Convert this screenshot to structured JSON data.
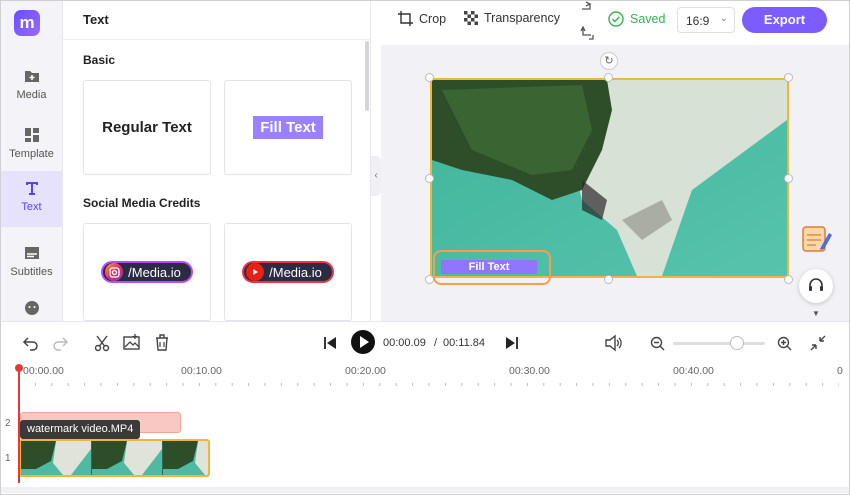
{
  "rail": {
    "logo": "m",
    "items": [
      {
        "label": "Media"
      },
      {
        "label": "Template"
      },
      {
        "label": "Text"
      },
      {
        "label": "Subtitles"
      }
    ]
  },
  "panel": {
    "title": "Text",
    "sections": {
      "basic": "Basic",
      "social": "Social Media Credits"
    },
    "cards": {
      "regular": "Regular Text",
      "fill": "Fill Text",
      "instagram": "/Media.io",
      "youtube": "/Media.io"
    }
  },
  "toolbar": {
    "crop": "Crop",
    "transparency": "Transparency",
    "saved": "Saved",
    "ratio": "16:9",
    "export": "Export"
  },
  "canvas": {
    "overlay_text": "Fill Text"
  },
  "playback": {
    "current": "00:00.09",
    "separator": "/",
    "total": "00:11.84"
  },
  "timeline": {
    "ticks": [
      "00:00.00",
      "00:10.00",
      "00:20.00",
      "00:30.00",
      "00:40.00"
    ],
    "track_numbers": [
      "2",
      "1"
    ],
    "clip_tooltip": "watermark video.MP4"
  },
  "colors": {
    "accent": "#7c5cff",
    "saved_green": "#37b24d",
    "playhead": "#e53935",
    "selection": "#f2b53a"
  }
}
